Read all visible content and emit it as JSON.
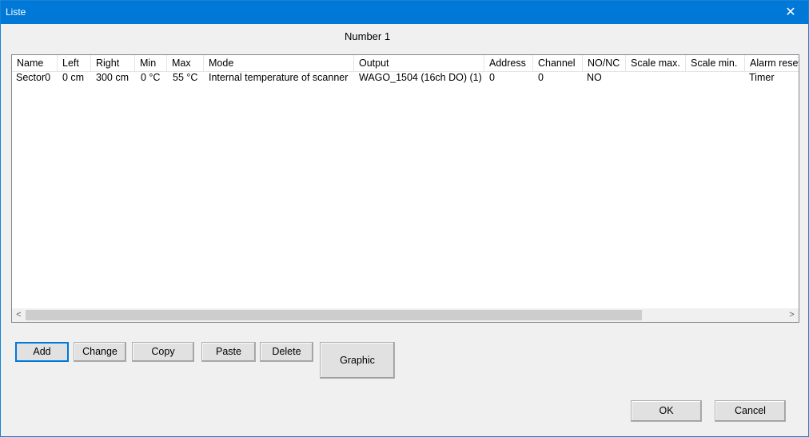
{
  "window": {
    "title": "Liste"
  },
  "number_label": "Number  1",
  "list": {
    "columns": [
      "Name",
      "Left",
      "Right",
      "Min",
      "Max",
      "Mode",
      "Output",
      "Address",
      "Channel",
      "NO/NC",
      "Scale max.",
      "Scale min.",
      "Alarm reset"
    ],
    "rows": [
      [
        "Sector0",
        "0 cm",
        "300 cm",
        "0 °C",
        "55 °C",
        "Internal temperature of scanner",
        "WAGO_1504 (16ch DO) (1)",
        "0",
        "0",
        "NO",
        "",
        "",
        "Timer"
      ]
    ]
  },
  "scrollbar": {
    "left_icon": "chevron-left-icon",
    "right_icon": "chevron-right-icon",
    "left_glyph": "<",
    "right_glyph": ">"
  },
  "buttons": {
    "add": "Add",
    "change": "Change",
    "copy": "Copy",
    "paste": "Paste",
    "delete": "Delete",
    "graphic": "Graphic",
    "ok": "OK",
    "cancel": "Cancel"
  },
  "icons": {
    "close": "close-icon",
    "close_glyph": "✕"
  },
  "colors": {
    "titlebar": "#0078d7",
    "background": "#f0f0f0"
  }
}
